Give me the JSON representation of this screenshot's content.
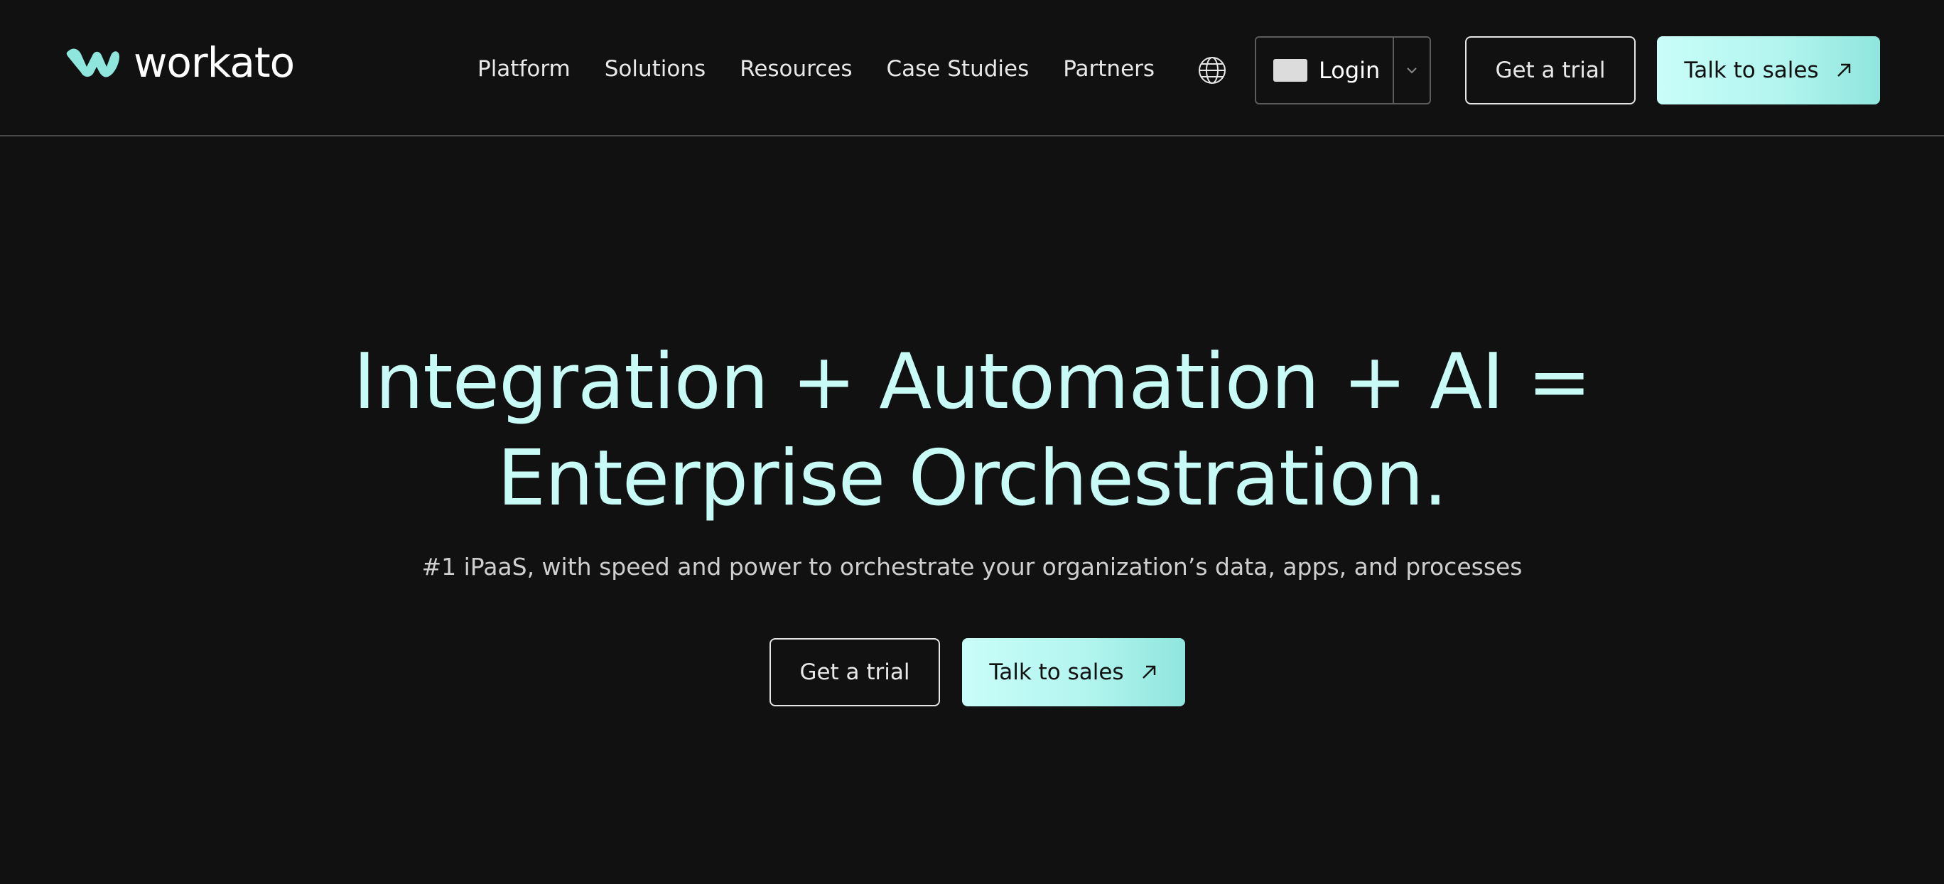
{
  "brand": {
    "name": "workato",
    "accent": "#8fe6dd",
    "accent_light": "#c9fdf9",
    "background": "#111111"
  },
  "nav": {
    "items": [
      "Platform",
      "Solutions",
      "Resources",
      "Case Studies",
      "Partners"
    ]
  },
  "header": {
    "language_icon": "globe-icon",
    "login_label": "Login",
    "login_dropdown_icon": "chevron-down-icon",
    "trial_label": "Get a trial",
    "sales_label": "Talk to sales",
    "sales_icon": "arrow-up-right-icon"
  },
  "hero": {
    "title_line1": "Integration + Automation + AI =",
    "title_line2": "Enterprise Orchestration.",
    "subtitle": "#1 iPaaS, with speed and power to orchestrate your organization’s data, apps, and processes",
    "trial_label": "Get a trial",
    "sales_label": "Talk to sales"
  }
}
